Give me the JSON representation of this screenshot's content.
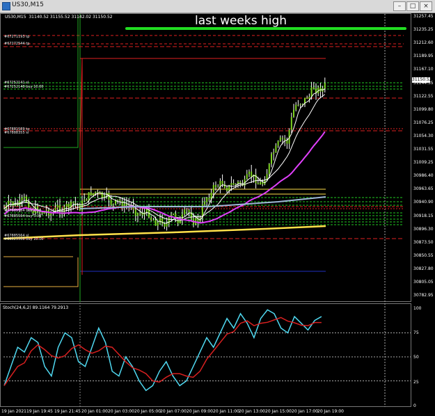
{
  "window": {
    "title": "US30,M15",
    "min_label": "–",
    "max_label": "□",
    "close_label": "×"
  },
  "chart": {
    "quote_line": "US30,M15  31140.52 31155.52 31142.02 31150.52",
    "annotation": "last weeks high",
    "current_price": "31150.52",
    "price_axis": [
      "31257.45",
      "31235.25",
      "31212.60",
      "31189.95",
      "31167.10",
      "31144.35",
      "31122.55",
      "31099.80",
      "31076.25",
      "31054.30",
      "31031.55",
      "31009.25",
      "30986.40",
      "30963.65",
      "30940.90",
      "30918.15",
      "30896.30",
      "30873.50",
      "30850.55",
      "30827.80",
      "30805.05",
      "30782.95"
    ],
    "order_labels": [
      "#67271193 tp",
      "#67272544 tp",
      "#67252141 sl",
      "#67252148 buy 10.00",
      "#67881589 tp",
      "#67888355 sl",
      "#67885564 buy 2.00",
      "#67885564 buy 3.00",
      "#67885564 sl",
      "#66525568 buy 10.00"
    ],
    "colors": {
      "background": "#000000",
      "up_candle": "#ffffff",
      "candle_body": "#7ed321",
      "ma_fast": "#ffffff",
      "ma_magenta": "#e040fb",
      "ma_blue": "#9fb7d8",
      "ma_yellow": "#ffe14a",
      "annotation_line": "#22dd22",
      "tp_line": "#e02020",
      "buy_line": "#22cc22",
      "stoch_main": "#4fd8f0",
      "stoch_signal": "#d82020"
    }
  },
  "stochastic": {
    "label": "Stoch(24,6,2) 89.1164 79.2913",
    "axis": [
      "100",
      "75",
      "50",
      "25",
      "0"
    ]
  },
  "time_axis": [
    "19 Jan 2021",
    "19 Jan 19:45",
    "19 Jan 21:45",
    "20 Jan 01:00",
    "20 Jan 03:00",
    "20 Jan 05:00",
    "20 Jan 07:00",
    "20 Jan 09:00",
    "20 Jan 11:00",
    "20 Jan 13:00",
    "20 Jan 15:00",
    "20 Jan 17:00",
    "20 Jan 19:00"
  ]
}
